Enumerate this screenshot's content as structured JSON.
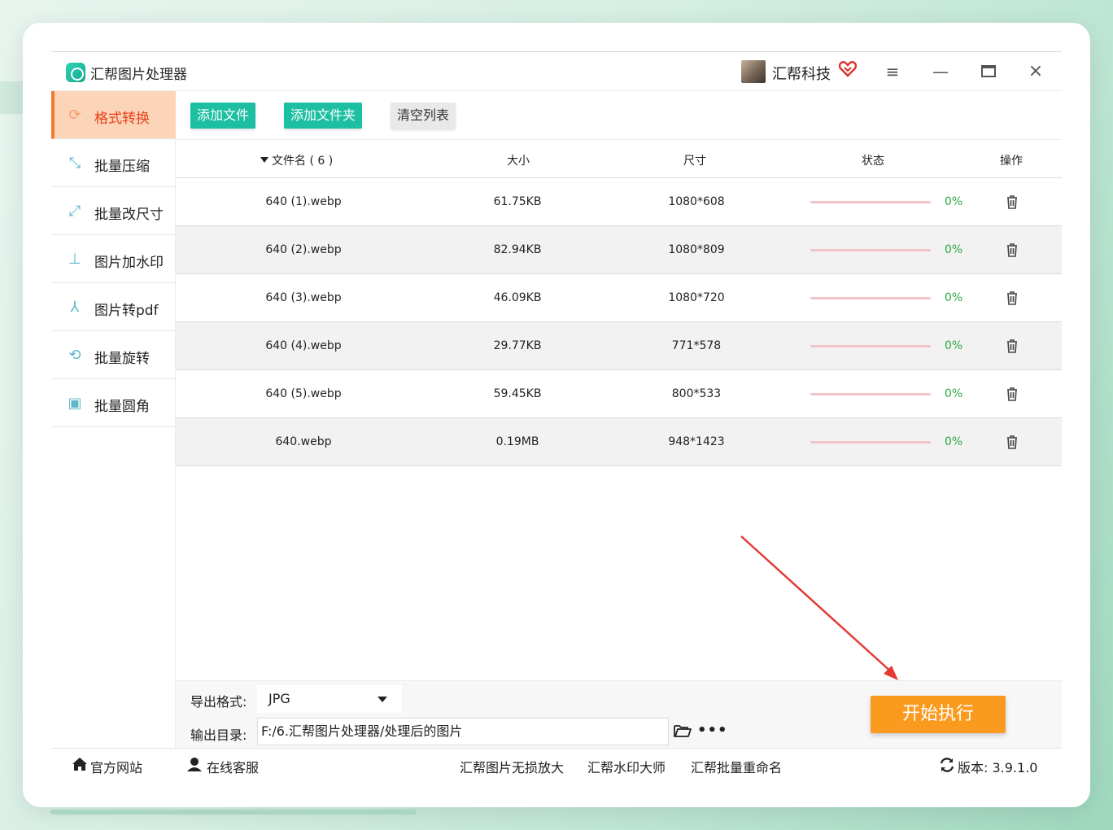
{
  "window": {
    "title": "汇帮图片处理器",
    "user_name": "汇帮科技",
    "vip_icon": "vip-heart-icon",
    "menu_glyph": "≡",
    "min_glyph": "—",
    "close_glyph": "×"
  },
  "sidebar": {
    "items": [
      {
        "label": "格式转换",
        "icon": "format-convert-icon",
        "active": true
      },
      {
        "label": "批量压缩",
        "icon": "compress-icon"
      },
      {
        "label": "批量改尺寸",
        "icon": "resize-icon"
      },
      {
        "label": "图片加水印",
        "icon": "watermark-icon"
      },
      {
        "label": "图片转pdf",
        "icon": "pdf-icon"
      },
      {
        "label": "批量旋转",
        "icon": "rotate-icon"
      },
      {
        "label": "批量圆角",
        "icon": "rounded-corner-icon"
      }
    ]
  },
  "toolbar": {
    "add_file": "添加文件",
    "add_folder": "添加文件夹",
    "clear_list": "清空列表"
  },
  "table": {
    "headers": {
      "name": "文件名 ( 6 )",
      "size": "大小",
      "dimension": "尺寸",
      "status": "状态",
      "operation": "操作"
    },
    "rows": [
      {
        "name": "640 (1).webp",
        "size": "61.75KB",
        "dimension": "1080*608",
        "progress": 0,
        "progress_text": "0%"
      },
      {
        "name": "640 (2).webp",
        "size": "82.94KB",
        "dimension": "1080*809",
        "progress": 0,
        "progress_text": "0%"
      },
      {
        "name": "640 (3).webp",
        "size": "46.09KB",
        "dimension": "1080*720",
        "progress": 0,
        "progress_text": "0%"
      },
      {
        "name": "640 (4).webp",
        "size": "29.77KB",
        "dimension": "771*578",
        "progress": 0,
        "progress_text": "0%"
      },
      {
        "name": "640 (5).webp",
        "size": "59.45KB",
        "dimension": "800*533",
        "progress": 0,
        "progress_text": "0%"
      },
      {
        "name": "640.webp",
        "size": "0.19MB",
        "dimension": "948*1423",
        "progress": 0,
        "progress_text": "0%"
      }
    ]
  },
  "settings": {
    "format_label": "导出格式:",
    "format_value": "JPG",
    "dir_label": "输出目录:",
    "dir_value": "F:/6.汇帮图片处理器/处理后的图片",
    "more_glyph": "•••",
    "start_button": "开始执行"
  },
  "footer": {
    "home": "官方网站",
    "service": "在线客服",
    "link1": "汇帮图片无损放大",
    "link2": "汇帮水印大师",
    "link3": "汇帮批量重命名",
    "version": "版本: 3.9.1.0"
  },
  "colors": {
    "accent_green": "#1dbfa3",
    "active_tab_bg": "#fcd4b8",
    "active_tab_text": "#e8401a",
    "start_button": "#fa9a1e",
    "progress_text": "#28a745",
    "arrow": "#e53935"
  }
}
